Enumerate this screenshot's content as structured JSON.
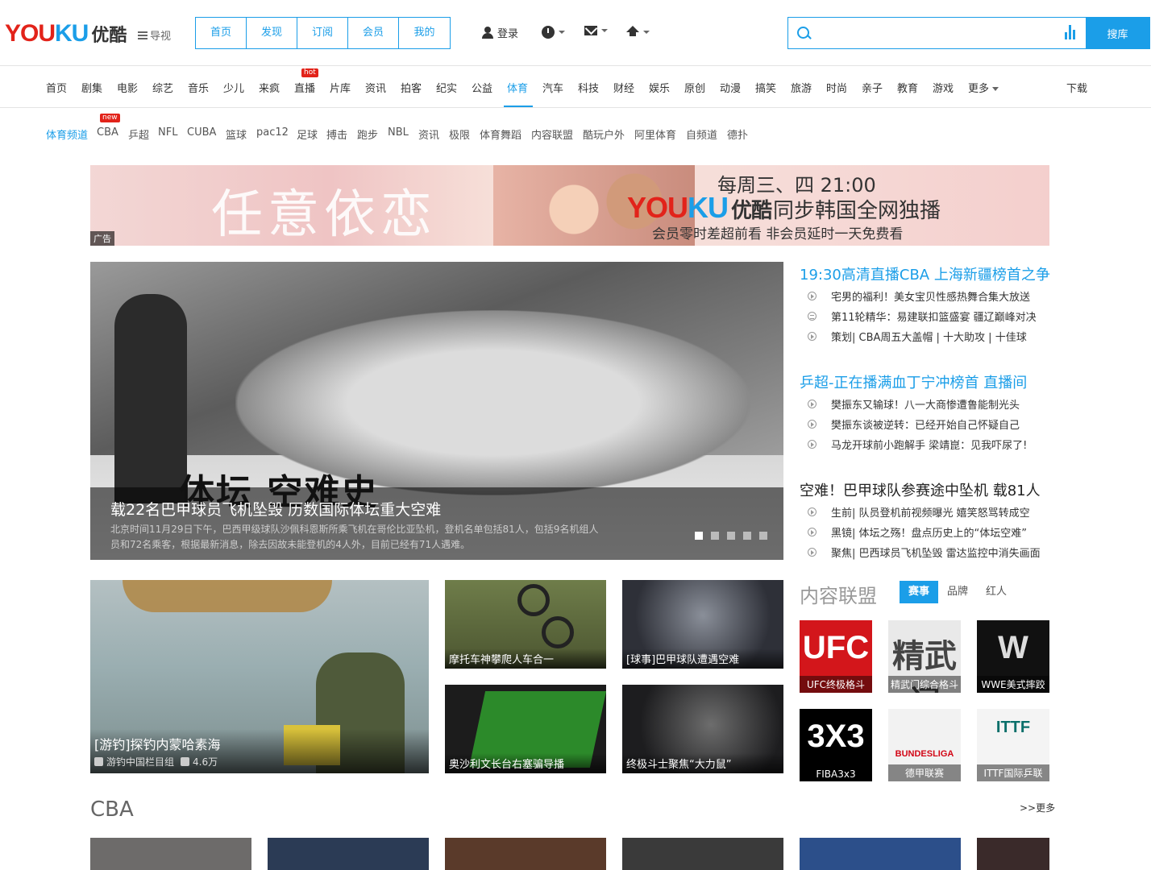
{
  "logo": {
    "you": "YOU",
    "ku": "KU",
    "cn": "优酷"
  },
  "guide": "导视",
  "top_nav": [
    "首页",
    "发现",
    "订阅",
    "会员",
    "我的"
  ],
  "login": "登录",
  "search": {
    "placeholder": "",
    "button": "搜库"
  },
  "channels": {
    "items": [
      "首页",
      "剧集",
      "电影",
      "综艺",
      "音乐",
      "少儿",
      "来疯",
      "直播",
      "片库",
      "资讯",
      "拍客",
      "纪实",
      "公益",
      "体育",
      "汽车",
      "科技",
      "财经",
      "娱乐",
      "原创",
      "动漫",
      "搞笑",
      "旅游",
      "时尚",
      "亲子",
      "教育",
      "游戏",
      "更多"
    ],
    "active": "体育",
    "hot_badge": "hot",
    "download": "下载"
  },
  "subnav": {
    "items": [
      "体育频道",
      "CBA",
      "乒超",
      "NFL",
      "CUBA",
      "篮球",
      "pac12",
      "足球",
      "搏击",
      "跑步",
      "NBL",
      "资讯",
      "极限",
      "体育舞蹈",
      "内容联盟",
      "酷玩户外",
      "阿里体育",
      "自频道",
      "德扑"
    ],
    "active": "体育频道",
    "new_badge": "new"
  },
  "ad": {
    "script": "任意依恋",
    "line1": "每周三、四 21:00",
    "yk_you": "YOU",
    "yk_ku": "KU",
    "yk_cn": "优酷",
    "line2": "同步韩国全网独播",
    "line3": "会员零时差超前看 非会员延时一天免费看",
    "tag": "广告"
  },
  "hero": {
    "big_text": "体坛 空难史",
    "title": "载22名巴甲球员飞机坠毁 历数国际体坛重大空难",
    "desc": "北京时间11月29日下午，巴西甲级球队沙佩科恩斯所乘飞机在哥伦比亚坠机，登机名单包括81人，包括9名机组人员和72名乘客，根据最新消息，除去因故未能登机的4人外，目前已经有71人遇难。",
    "slides": 5,
    "active_slide": 1
  },
  "news_blocks": [
    {
      "head": "19:30高清直播CBA 上海新疆榜首之争",
      "head_color": "#1b9ee8",
      "items": [
        {
          "icon": "play",
          "text": "宅男的福利！美女宝贝性感热舞合集大放送"
        },
        {
          "icon": "list",
          "text": "第11轮精华：易建联扣篮盛宴 疆辽巅峰对决"
        },
        {
          "icon": "play",
          "text": "策划| CBA周五大盖帽 |  十大助攻 |  十佳球"
        }
      ]
    },
    {
      "head": "乒超-正在播满血丁宁冲榜首 直播间",
      "head_color": "#1b9ee8",
      "items": [
        {
          "icon": "play",
          "text": "樊振东又输球！八一大商惨遭鲁能制光头"
        },
        {
          "icon": "play",
          "text": "樊振东谈被逆转：已经开始自己怀疑自己"
        },
        {
          "icon": "play",
          "text": "马龙开球前小跑解手 梁靖崑：见我吓尿了!"
        }
      ]
    },
    {
      "head": "空难！巴甲球队参赛途中坠机 载81人",
      "head_color": "#222",
      "items": [
        {
          "icon": "play",
          "text": "生前| 队员登机前视频曝光 嬉笑怒骂转成空"
        },
        {
          "icon": "play",
          "text": "黑镜| 体坛之殇！盘点历史上的“体坛空难”"
        },
        {
          "icon": "play",
          "text": "聚焦| 巴西球员飞机坠毁 雷达监控中消失画面"
        }
      ]
    }
  ],
  "videos": [
    {
      "title": "[游钓]探钓内蒙哈素海",
      "user": "游钓中国栏目组",
      "plays": "4.6万",
      "bg": "#8fa3a8"
    },
    {
      "title": "摩托车神攀爬人车合一",
      "bg": "#5d6b3d"
    },
    {
      "title": "[球事]巴甲球队遭遇空难",
      "bg": "#3c3f4a"
    },
    {
      "title": "奥沙利文长台右塞骗导播",
      "bg": "#2f6b2c"
    },
    {
      "title": "终极斗士聚焦“大力鼠”",
      "bg": "#2a2a2e"
    }
  ],
  "alliance": {
    "title": "内容联盟",
    "tabs": [
      "赛事",
      "品牌",
      "红人"
    ],
    "active_tab": "赛事",
    "brands": [
      {
        "mark": "UFC",
        "label": "UFC终极格斗",
        "bg": "#d3161b",
        "fg": "#ffffff"
      },
      {
        "mark": "精武门",
        "label": "精武门综合格斗",
        "bg": "#e9e9e9",
        "fg": "#444444"
      },
      {
        "mark": "W",
        "label": "WWE美式摔跤",
        "bg": "#111111",
        "fg": "#dddddd"
      },
      {
        "mark": "3X3",
        "label": "FIBA3x3",
        "bg": "#000000",
        "fg": "#ffffff"
      },
      {
        "mark": "BUNDESLIGA",
        "label": "德甲联赛",
        "bg": "#f2f2f2",
        "fg": "#d20515"
      },
      {
        "mark": "ITTF",
        "label": "ITTF国际乒联",
        "bg": "#f4f4f4",
        "fg": "#0a6f6a"
      }
    ]
  },
  "cba": {
    "title": "CBA",
    "more": ">>更多",
    "thumbs": [
      "#6d6b6a",
      "#2b3b55",
      "#5a3a2a",
      "#3a3a3a",
      "#2c4f8a",
      "#3a2a2a"
    ]
  }
}
